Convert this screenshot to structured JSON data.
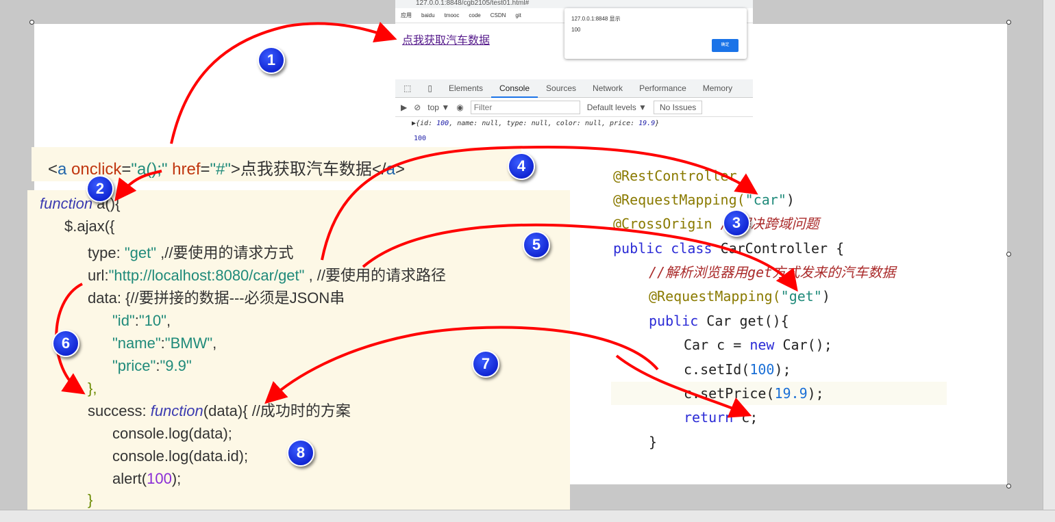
{
  "browser": {
    "address": "127.0.0.1:8848/cgb2105/test01.html#",
    "bookmarks": [
      "应用",
      "baidu",
      "tmooc",
      "code",
      "CSDN",
      "git"
    ],
    "link": "点我获取汽车数据",
    "alert": {
      "title": "127.0.0.1:8848 显示",
      "message": "100",
      "ok": "确定"
    },
    "devtools": {
      "tabs": [
        "Elements",
        "Console",
        "Sources",
        "Network",
        "Performance",
        "Memory"
      ],
      "active_tab": "Console",
      "context": "top ▼",
      "filter_placeholder": "Filter",
      "levels": "Default levels ▼",
      "issues": "No Issues",
      "console": {
        "obj_pre": "▶{id: ",
        "id": "100",
        "obj_mid": ", name: null, type: null, color: null, price: ",
        "price": "19.9",
        "obj_post": "}",
        "line2": "100"
      }
    }
  },
  "snippet": {
    "p1": "<",
    "p2": "a",
    "p3": " onclick",
    "p4": "=",
    "p5": "\"a();\"",
    "p6": " href",
    "p7": "=",
    "p8": "\"#\"",
    "p9": ">点我获取汽车数据</",
    "p10": "a",
    "p11": ">"
  },
  "left_code": {
    "l1a": "function",
    "l1b": " a(){",
    "l2": "$.ajax({",
    "l3a": "type: ",
    "l3b": "\"get\"",
    "l3c": " ,//要使用的请求方式",
    "l4a": "url:",
    "l4b": "\"http://localhost:8080/car/get\"",
    "l4c": " , //要使用的请求路径",
    "l5": "data: {//要拼接的数据---必须是JSON串",
    "l6a": "\"id\"",
    "l6b": ":",
    "l6c": "\"10\"",
    "l6d": ",",
    "l7a": "\"name\"",
    "l7b": ":",
    "l7c": "\"BMW\"",
    "l7d": ",",
    "l8a": "\"price\"",
    "l8b": ":",
    "l8c": "\"9.9\"",
    "l9": "},",
    "l10a": "success: ",
    "l10b": "function",
    "l10c": "(data){ //成功时的方案",
    "l11": "console.log(data);",
    "l12": "console.log(data.id);",
    "l13a": "alert(",
    "l13b": "100",
    "l13c": ");",
    "l14": "}"
  },
  "right_code": {
    "r1": "@RestController",
    "r2a": "@RequestMapping(",
    "r2b": "\"car\"",
    "r2c": ")",
    "r3a": "@CrossOrigin ",
    "r3b": "//解决跨域问题",
    "r4a": "public class ",
    "r4b": "CarController {",
    "r5": "//解析浏览器用get方式发来的汽车数据",
    "r6a": "@RequestMapping(",
    "r6b": "\"get\"",
    "r6c": ")",
    "r7a": "public ",
    "r7b": "Car get(){",
    "r8a": "Car c = ",
    "r8b": "new ",
    "r8c": "Car();",
    "r9a": "c.setId(",
    "r9b": "100",
    "r9c": ");",
    "r10a": "c.setPrice(",
    "r10b": "19.9",
    "r10c": ");",
    "r11a": "return ",
    "r11b": "c;",
    "r12": "}"
  },
  "badges": [
    "1",
    "2",
    "3",
    "4",
    "5",
    "6",
    "7",
    "8"
  ],
  "colors": {
    "arrow": "#ff0000",
    "badge": "#0a1ee0",
    "code_bg": "#fdf8e6"
  }
}
